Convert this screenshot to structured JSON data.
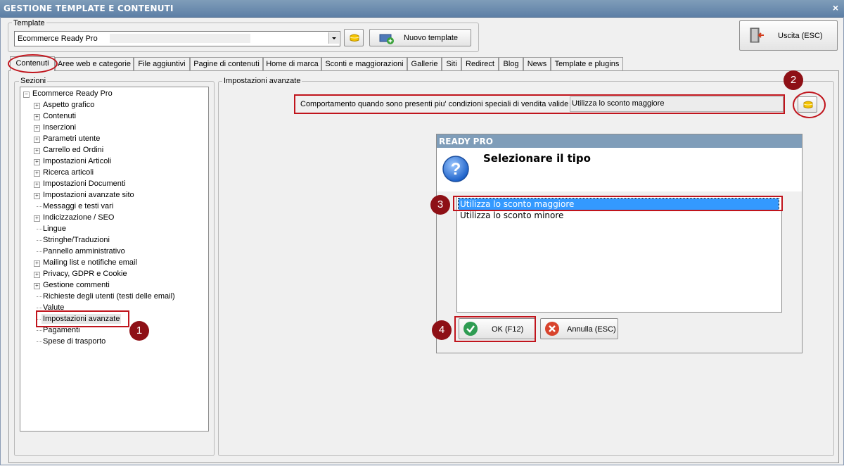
{
  "window": {
    "title": "GESTIONE TEMPLATE E CONTENUTI",
    "close": "×"
  },
  "template": {
    "group_label": "Template",
    "combo_value": "Ecommerce Ready Pro",
    "new_template_label": "Nuovo template"
  },
  "exit_button": {
    "label": "Uscita (ESC)"
  },
  "tabs": [
    {
      "label": "Contenuti"
    },
    {
      "label": "Aree web e categorie"
    },
    {
      "label": "File aggiuntivi"
    },
    {
      "label": "Pagine di contenuti"
    },
    {
      "label": "Home di marca"
    },
    {
      "label": "Sconti e maggiorazioni"
    },
    {
      "label": "Gallerie"
    },
    {
      "label": "Siti"
    },
    {
      "label": "Redirect"
    },
    {
      "label": "Blog"
    },
    {
      "label": "News"
    },
    {
      "label": "Template e plugins"
    }
  ],
  "sections": {
    "group_label": "Sezioni",
    "root": "Ecommerce Ready Pro",
    "items": [
      {
        "label": "Aspetto grafico",
        "expandable": true
      },
      {
        "label": "Contenuti",
        "expandable": true
      },
      {
        "label": "Inserzioni",
        "expandable": true
      },
      {
        "label": "Parametri utente",
        "expandable": true
      },
      {
        "label": "Carrello ed Ordini",
        "expandable": true
      },
      {
        "label": "Impostazioni Articoli",
        "expandable": true
      },
      {
        "label": "Ricerca articoli",
        "expandable": true
      },
      {
        "label": "Impostazioni Documenti",
        "expandable": true
      },
      {
        "label": "Impostazioni avanzate sito",
        "expandable": true
      },
      {
        "label": "Messaggi e testi vari",
        "expandable": false
      },
      {
        "label": "Indicizzazione / SEO",
        "expandable": true
      },
      {
        "label": "Lingue",
        "expandable": false
      },
      {
        "label": "Stringhe/Traduzioni",
        "expandable": false
      },
      {
        "label": "Pannello amministrativo",
        "expandable": false
      },
      {
        "label": "Mailing list e notifiche email",
        "expandable": true
      },
      {
        "label": "Privacy, GDPR e Cookie",
        "expandable": true
      },
      {
        "label": "Gestione commenti",
        "expandable": true
      },
      {
        "label": "Richieste degli utenti (testi delle email)",
        "expandable": false
      },
      {
        "label": "Valute",
        "expandable": false
      },
      {
        "label": "Impostazioni avanzate",
        "expandable": false,
        "selected": true
      },
      {
        "label": "Pagamenti",
        "expandable": false
      },
      {
        "label": "Spese di trasporto",
        "expandable": false
      }
    ]
  },
  "advanced": {
    "group_label": "Impostazioni avanzate",
    "field_label": "Comportamento quando sono presenti piu' condizioni speciali di vendita valide :",
    "field_value": "Utilizza lo sconto maggiore"
  },
  "dialog": {
    "title": "READY PRO",
    "heading": "Selezionare il tipo",
    "options": [
      "Utilizza lo sconto maggiore",
      "Utilizza lo sconto minore"
    ],
    "selected_index": 0,
    "ok_label": "OK (F12)",
    "cancel_label": "Annulla (ESC)"
  },
  "annotations": {
    "step1": "1",
    "step2": "2",
    "step3": "3",
    "step4": "4"
  },
  "colors": {
    "annotation_red": "#c0141c",
    "badge": "#8e1016",
    "selection": "#3399ff",
    "titlebar": "#7f9db9"
  }
}
